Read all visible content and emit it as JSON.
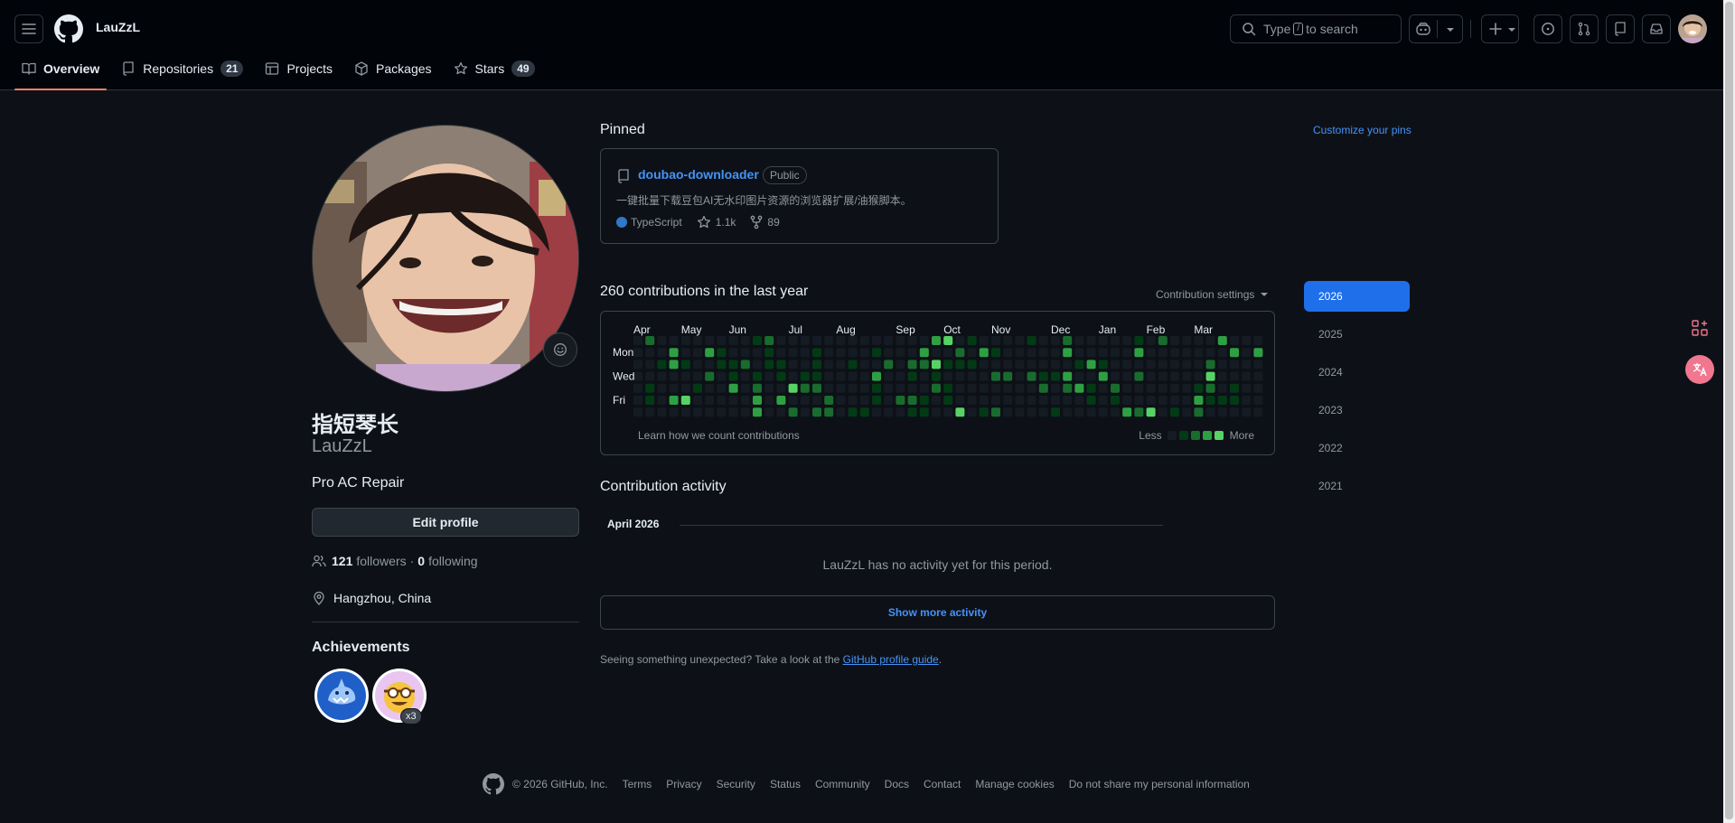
{
  "header": {
    "owner": "LauZzL",
    "search": {
      "prefix": "Type",
      "key": "/",
      "suffix": "to search"
    }
  },
  "tabs": [
    {
      "label": "Overview",
      "icon": "book-icon",
      "selected": true
    },
    {
      "label": "Repositories",
      "count": "21",
      "icon": "repo-icon"
    },
    {
      "label": "Projects",
      "icon": "table-icon"
    },
    {
      "label": "Packages",
      "icon": "package-icon"
    },
    {
      "label": "Stars",
      "count": "49",
      "icon": "star-icon"
    }
  ],
  "profile": {
    "fullname": "指短琴长",
    "username": "LauZzL",
    "bio": "Pro AC Repair",
    "edit_label": "Edit profile",
    "followers_count": "121",
    "followers_label": "followers",
    "separator": "·",
    "following_count": "0",
    "following_label": "following",
    "location": "Hangzhou, China",
    "achievements_title": "Achievements",
    "achievement_multiplier": "x3"
  },
  "pinned": {
    "title": "Pinned",
    "customize_label": "Customize your pins",
    "repo": {
      "name": "doubao-downloader",
      "visibility": "Public",
      "description": "一键批量下载豆包AI无水印图片资源的浏览器扩展/油猴脚本。",
      "language": "TypeScript",
      "language_color": "#3178c6",
      "stars": "1.1k",
      "forks": "89"
    }
  },
  "contributions": {
    "title": "260 contributions in the last year",
    "settings_label": "Contribution settings",
    "months": [
      "Apr",
      "May",
      "Jun",
      "Jul",
      "Aug",
      "Sep",
      "Oct",
      "Nov",
      "Dec",
      "Jan",
      "Feb",
      "Mar"
    ],
    "days": [
      "Mon",
      "Wed",
      "Fri"
    ],
    "learn_label": "Learn how we count contributions",
    "legend_less": "Less",
    "legend_more": "More",
    "level_colors": [
      "#151b23",
      "#033a16",
      "#196c2e",
      "#2ea043",
      "#56d364"
    ]
  },
  "activity": {
    "title": "Contribution activity",
    "month": "April 2026",
    "empty_text": "LauZzL has no activity yet for this period.",
    "show_more_label": "Show more activity",
    "unexpected_text": "Seeing something unexpected? Take a look at the",
    "guide_link": "GitHub profile guide",
    "period": "."
  },
  "years": [
    "2026",
    "2025",
    "2024",
    "2023",
    "2022",
    "2021"
  ],
  "footer": {
    "copyright": "© 2026 GitHub, Inc.",
    "links": [
      "Terms",
      "Privacy",
      "Security",
      "Status",
      "Community",
      "Docs",
      "Contact",
      "Manage cookies",
      "Do not share my personal information"
    ]
  }
}
